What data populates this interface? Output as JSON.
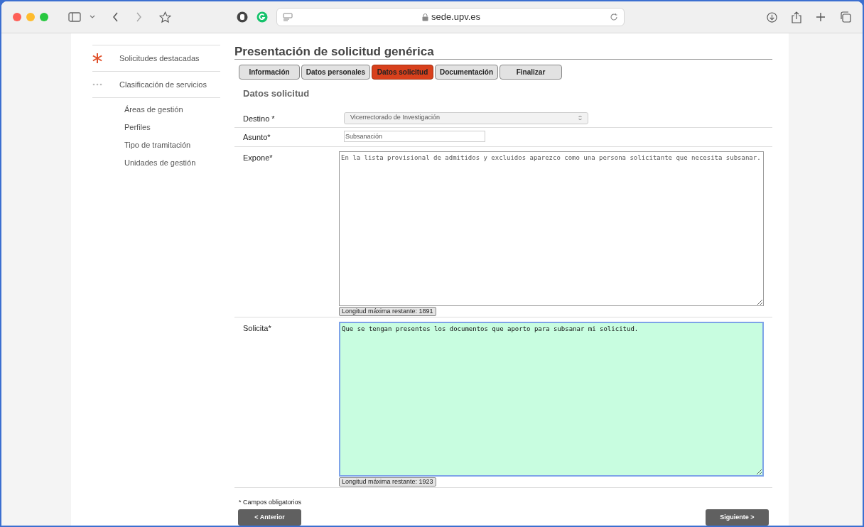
{
  "browser": {
    "url": "sede.upv.es"
  },
  "sidebar": {
    "items": [
      {
        "label": "Solicitudes destacadas",
        "kind": "star"
      },
      {
        "label": "Clasificación de servicios",
        "kind": "dots"
      }
    ],
    "subitems": [
      "Áreas de gestión",
      "Perfiles",
      "Tipo de tramitación",
      "Unidades de gestión"
    ]
  },
  "title": "Presentación de solicitud genérica",
  "tabs": [
    {
      "label": "Información",
      "selected": false
    },
    {
      "label": "Datos personales",
      "selected": false
    },
    {
      "label": "Datos solicitud",
      "selected": true
    },
    {
      "label": "Documentación",
      "selected": false
    },
    {
      "label": "Finalizar",
      "selected": false
    }
  ],
  "section": "Datos solicitud",
  "fields": [
    {
      "label": "Destino *",
      "kind": "select",
      "value": "Vicerrectorado de Investigación"
    },
    {
      "label": "Asunto*",
      "kind": "input",
      "value": "Subsanación"
    },
    {
      "label": "Expone*",
      "kind": "textarea",
      "value": "En la lista provisional de admitidos y excluidos aparezco como una persona solicitante que necesita subsanar.",
      "counter": "Longitud máxima restante: 1891",
      "focused": false
    },
    {
      "label": "Solicita*",
      "kind": "textarea",
      "value": "Que se tengan presentes los documentos que aporto para subsanar mi solicitud.",
      "counter": "Longitud máxima restante: 1923",
      "focused": true
    }
  ],
  "note": "* Campos obligatorios",
  "buttons": {
    "previous": "< Anterior",
    "next": "Siguiente >"
  }
}
